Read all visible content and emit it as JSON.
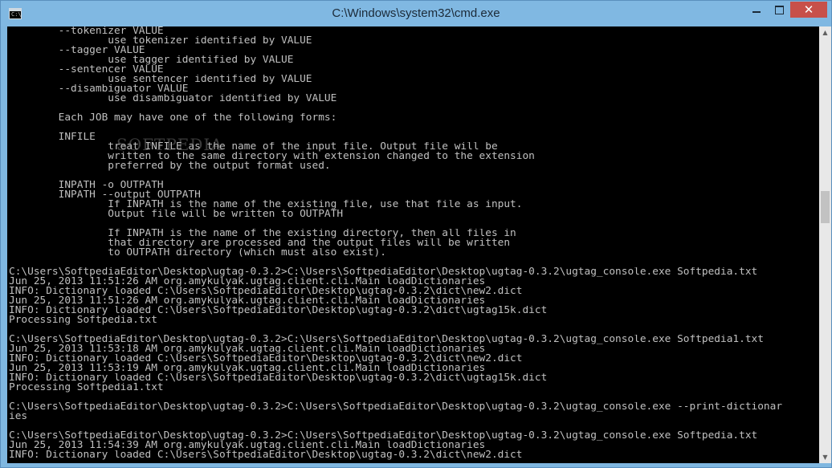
{
  "window": {
    "title": "C:\\Windows\\system32\\cmd.exe",
    "icon_text": "C:\\",
    "controls": {
      "minimize_icon": "minimize-icon",
      "maximize_icon": "maximize-icon",
      "close_glyph": "✕"
    }
  },
  "watermark": "SOFTPEDIA",
  "console": {
    "foreground": "#c0c0c0",
    "background": "#000000",
    "lines": [
      "        --tokenizer VALUE",
      "                use tokenizer identified by VALUE",
      "        --tagger VALUE",
      "                use tagger identified by VALUE",
      "        --sentencer VALUE",
      "                use sentencer identified by VALUE",
      "        --disambiguator VALUE",
      "                use disambiguator identified by VALUE",
      "",
      "        Each JOB may have one of the following forms:",
      "",
      "        INFILE",
      "                treat INFILE as the name of the input file. Output file will be",
      "                written to the same directory with extension changed to the extension",
      "                preferred by the output format used.",
      "",
      "        INPATH -o OUTPATH",
      "        INPATH --output OUTPATH",
      "                If INPATH is the name of the existing file, use that file as input.",
      "                Output file will be written to OUTPATH",
      "",
      "                If INPATH is the name of the existing directory, then all files in",
      "                that directory are processed and the output files will be written",
      "                to OUTPATH directory (which must also exist).",
      "",
      "C:\\Users\\SoftpediaEditor\\Desktop\\ugtag-0.3.2>C:\\Users\\SoftpediaEditor\\Desktop\\ugtag-0.3.2\\ugtag_console.exe Softpedia.txt",
      "Jun 25, 2013 11:51:26 AM org.amykulyak.ugtag.client.cli.Main loadDictionaries",
      "INFO: Dictionary loaded C:\\Users\\SoftpediaEditor\\Desktop\\ugtag-0.3.2\\dict\\new2.dict",
      "Jun 25, 2013 11:51:26 AM org.amykulyak.ugtag.client.cli.Main loadDictionaries",
      "INFO: Dictionary loaded C:\\Users\\SoftpediaEditor\\Desktop\\ugtag-0.3.2\\dict\\ugtag15k.dict",
      "Processing Softpedia.txt",
      "",
      "C:\\Users\\SoftpediaEditor\\Desktop\\ugtag-0.3.2>C:\\Users\\SoftpediaEditor\\Desktop\\ugtag-0.3.2\\ugtag_console.exe Softpedia1.txt",
      "Jun 25, 2013 11:53:18 AM org.amykulyak.ugtag.client.cli.Main loadDictionaries",
      "INFO: Dictionary loaded C:\\Users\\SoftpediaEditor\\Desktop\\ugtag-0.3.2\\dict\\new2.dict",
      "Jun 25, 2013 11:53:19 AM org.amykulyak.ugtag.client.cli.Main loadDictionaries",
      "INFO: Dictionary loaded C:\\Users\\SoftpediaEditor\\Desktop\\ugtag-0.3.2\\dict\\ugtag15k.dict",
      "Processing Softpedia1.txt",
      "",
      "C:\\Users\\SoftpediaEditor\\Desktop\\ugtag-0.3.2>C:\\Users\\SoftpediaEditor\\Desktop\\ugtag-0.3.2\\ugtag_console.exe --print-dictionar",
      "ies",
      "",
      "C:\\Users\\SoftpediaEditor\\Desktop\\ugtag-0.3.2>C:\\Users\\SoftpediaEditor\\Desktop\\ugtag-0.3.2\\ugtag_console.exe Softpedia.txt",
      "Jun 25, 2013 11:54:39 AM org.amykulyak.ugtag.client.cli.Main loadDictionaries",
      "INFO: Dictionary loaded C:\\Users\\SoftpediaEditor\\Desktop\\ugtag-0.3.2\\dict\\new2.dict"
    ]
  },
  "scrollbar": {
    "up_glyph": "▲",
    "down_glyph": "▼"
  }
}
